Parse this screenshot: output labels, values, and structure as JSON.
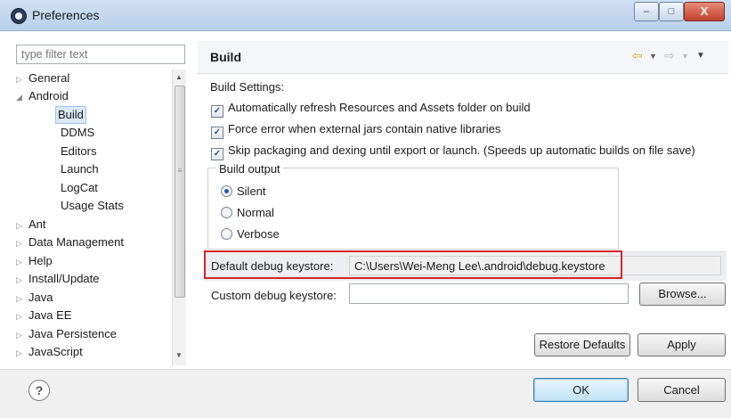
{
  "window": {
    "title": "Preferences",
    "minimize_label": "–",
    "maximize_label": "□",
    "close_label": "X"
  },
  "filter": {
    "placeholder": "type filter text"
  },
  "tree": {
    "items": [
      {
        "label": "General",
        "arrow": "▷"
      },
      {
        "label": "Android",
        "arrow": "◢"
      },
      {
        "label": "Build",
        "selected": true
      },
      {
        "label": "DDMS"
      },
      {
        "label": "Editors"
      },
      {
        "label": "Launch"
      },
      {
        "label": "LogCat"
      },
      {
        "label": "Usage Stats"
      },
      {
        "label": "Ant",
        "arrow": "▷"
      },
      {
        "label": "Data Management",
        "arrow": "▷"
      },
      {
        "label": "Help",
        "arrow": "▷"
      },
      {
        "label": "Install/Update",
        "arrow": "▷"
      },
      {
        "label": "Java",
        "arrow": "▷"
      },
      {
        "label": "Java EE",
        "arrow": "▷"
      },
      {
        "label": "Java Persistence",
        "arrow": "▷"
      },
      {
        "label": "JavaScript",
        "arrow": "▷"
      }
    ]
  },
  "header": {
    "title": "Build",
    "back_icon": "⇦",
    "forward_icon": "⇨",
    "menu_icon": "▼"
  },
  "build_settings": {
    "label": "Build Settings:",
    "options": [
      {
        "label": "Automatically refresh Resources and Assets folder on build",
        "checked": true
      },
      {
        "label": "Force error when external jars contain native libraries",
        "checked": true
      },
      {
        "label": "Skip packaging and dexing until export or launch. (Speeds up automatic builds on file save)",
        "checked": true
      }
    ]
  },
  "build_output": {
    "legend": "Build output",
    "options": [
      {
        "label": "Silent",
        "selected": true
      },
      {
        "label": "Normal",
        "selected": false
      },
      {
        "label": "Verbose",
        "selected": false
      }
    ]
  },
  "keystore": {
    "default_label": "Default debug keystore:",
    "default_value": "C:\\Users\\Wei-Meng Lee\\.android\\debug.keystore",
    "custom_label": "Custom debug keystore:",
    "custom_value": "",
    "browse_label": "Browse..."
  },
  "actions": {
    "restore_label": "Restore Defaults",
    "apply_label": "Apply",
    "ok_label": "OK",
    "cancel_label": "Cancel",
    "help_glyph": "?"
  },
  "colors": {
    "highlight_border": "#d8242b",
    "title_bar": "#c4d8ef",
    "selection": "#dbe9f8"
  }
}
